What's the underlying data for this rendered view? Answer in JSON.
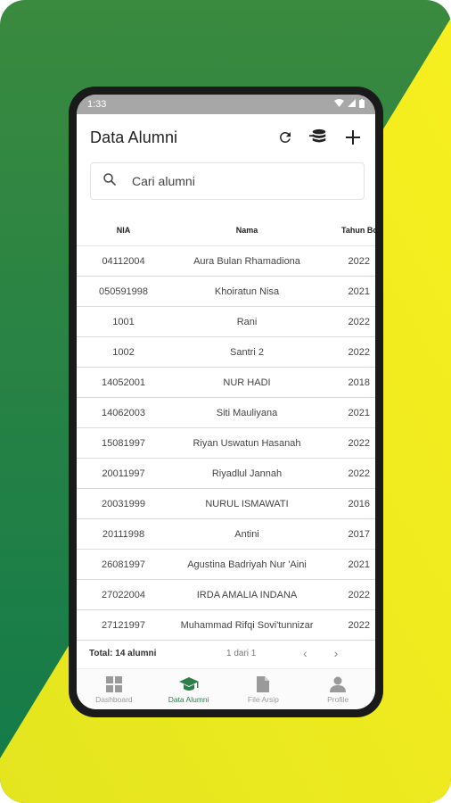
{
  "status": {
    "time": "1:33"
  },
  "header": {
    "title": "Data Alumni",
    "icons": [
      "refresh-icon",
      "database-icon",
      "add-icon"
    ]
  },
  "search": {
    "placeholder": "Cari alumni"
  },
  "table": {
    "columns": [
      "NIA",
      "Nama",
      "Tahun Boyo"
    ],
    "rows": [
      {
        "nia": "04112004",
        "nama": "Aura Bulan Rhamadiona",
        "tahun": "2022"
      },
      {
        "nia": "050591998",
        "nama": "Khoiratun Nisa",
        "tahun": "2021"
      },
      {
        "nia": "1001",
        "nama": "Rani",
        "tahun": "2022"
      },
      {
        "nia": "1002",
        "nama": "Santri 2",
        "tahun": "2022"
      },
      {
        "nia": "14052001",
        "nama": "NUR HADI",
        "tahun": "2018"
      },
      {
        "nia": "14062003",
        "nama": "Siti Mauliyana",
        "tahun": "2021"
      },
      {
        "nia": "15081997",
        "nama": "Riyan Uswatun Hasanah",
        "tahun": "2022"
      },
      {
        "nia": "20011997",
        "nama": "Riyadlul Jannah",
        "tahun": "2022"
      },
      {
        "nia": "20031999",
        "nama": "NURUL ISMAWATI",
        "tahun": "2016"
      },
      {
        "nia": "20111998",
        "nama": "Antini",
        "tahun": "2017"
      },
      {
        "nia": "26081997",
        "nama": "Agustina Badriyah Nur 'Aini",
        "tahun": "2021"
      },
      {
        "nia": "27022004",
        "nama": "IRDA AMALIA INDANA",
        "tahun": "2022"
      },
      {
        "nia": "27121997",
        "nama": "Muhammad Rifqi Sovi'tunnizar",
        "tahun": "2022"
      }
    ]
  },
  "footer": {
    "total": "Total: 14 alumni",
    "page": "1 dari 1"
  },
  "bottom_nav": [
    {
      "label": "Dashboard",
      "icon": "grid-icon",
      "active": false
    },
    {
      "label": "Data Alumni",
      "icon": "graduation-cap-icon",
      "active": true
    },
    {
      "label": "File Arsip",
      "icon": "file-icon",
      "active": false
    },
    {
      "label": "Profile",
      "icon": "person-icon",
      "active": false
    }
  ],
  "colors": {
    "accent": "#2e7d4a",
    "bg_green": "#1f7a45",
    "bg_yellow": "#f2ea1e"
  }
}
